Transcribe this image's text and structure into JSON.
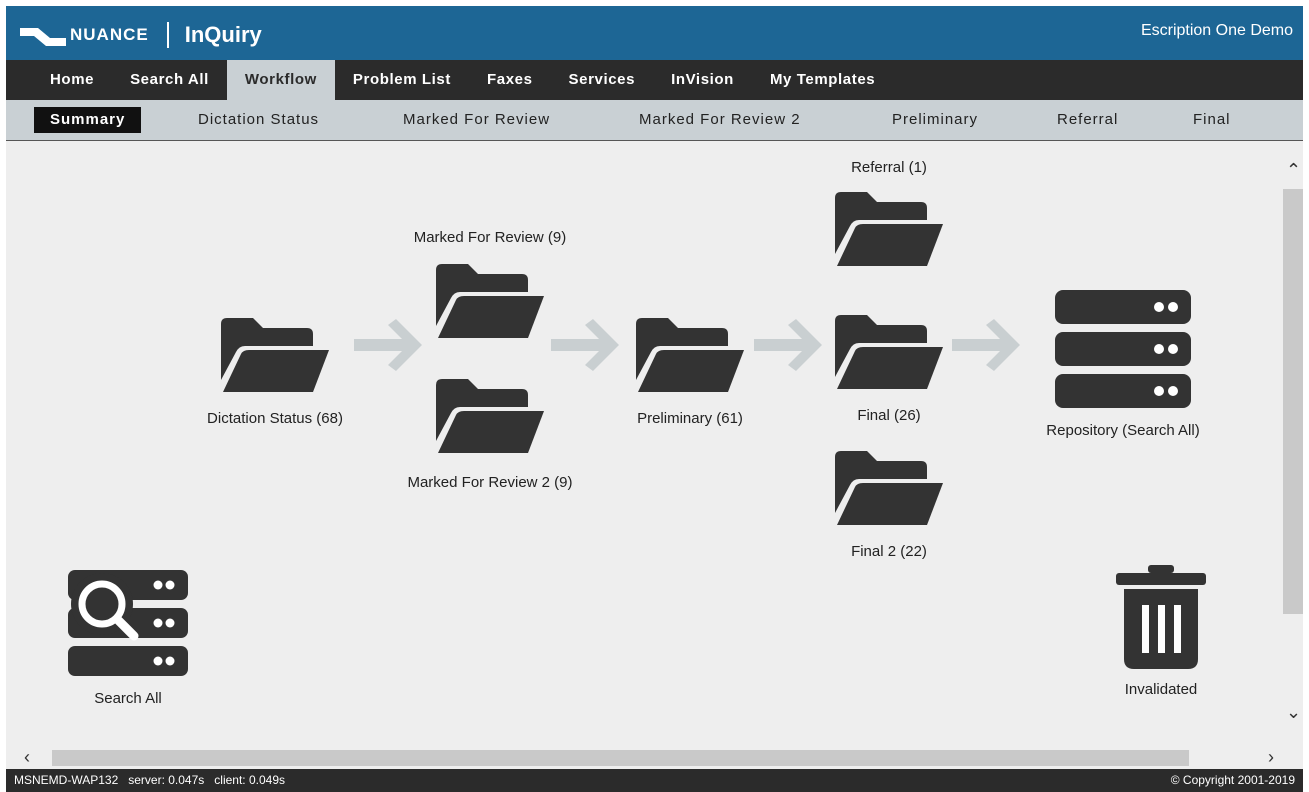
{
  "header": {
    "brand": "NUANCE",
    "app_title": "InQuiry",
    "workspace": "Escription One Demo"
  },
  "main_nav": [
    {
      "label": "Home"
    },
    {
      "label": "Search All"
    },
    {
      "label": "Workflow",
      "active": true
    },
    {
      "label": "Problem List"
    },
    {
      "label": "Faxes"
    },
    {
      "label": "Services"
    },
    {
      "label": "InVision"
    },
    {
      "label": "My Templates"
    }
  ],
  "sub_nav": [
    {
      "label": "Summary",
      "active": true
    },
    {
      "label": "Dictation Status"
    },
    {
      "label": "Marked For Review"
    },
    {
      "label": "Marked For Review 2"
    },
    {
      "label": "Preliminary"
    },
    {
      "label": "Referral"
    },
    {
      "label": "Final"
    }
  ],
  "workflow": {
    "dictation_status": "Dictation Status (68)",
    "marked_for_review": "Marked For Review (9)",
    "marked_for_review_2": "Marked For Review 2 (9)",
    "preliminary": "Preliminary (61)",
    "referral": "Referral (1)",
    "final": "Final (26)",
    "final_2": "Final 2 (22)",
    "repository": "Repository (Search All)",
    "search_all": "Search All",
    "invalidated": "Invalidated"
  },
  "icons": {
    "folder": "folder-open-icon",
    "server": "server-icon",
    "search_server": "search-database-icon",
    "trash": "trash-icon",
    "arrow": "arrow-right-icon"
  },
  "colors": {
    "header_bg": "#1d6695",
    "nav_bg": "#2b2b2b",
    "subnav_bg": "#c9d0d4",
    "icon": "#333333",
    "arrow": "#c9cfd1"
  },
  "footer": {
    "status": "MSNEMD-WAP132   server: 0.047s   client: 0.049s",
    "copyright": "© Copyright 2001-2019"
  }
}
